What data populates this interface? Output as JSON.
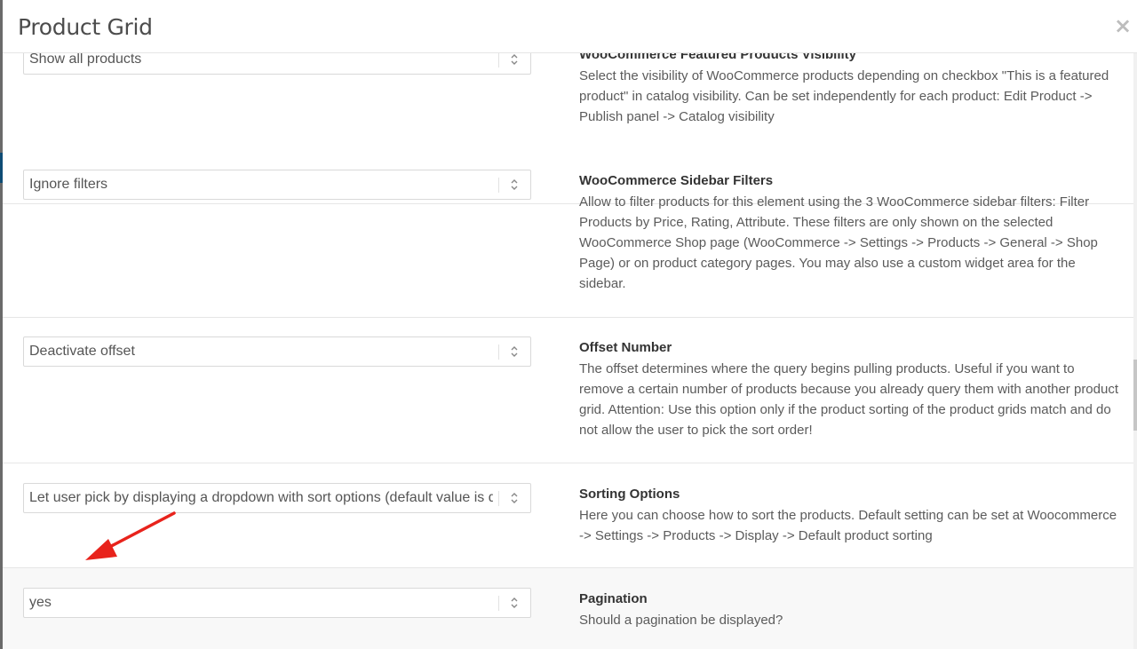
{
  "modal": {
    "title": "Product Grid",
    "close_label": "×"
  },
  "options": [
    {
      "value": "Show all products",
      "title": "WooCommerce Featured Products Visibility",
      "description": "Select the visibility of WooCommerce products depending on checkbox \"This is a featured product\" in catalog visibility. Can be set independently for each product: Edit Product -> Publish panel -> Catalog visibility"
    },
    {
      "value": "Ignore filters",
      "title": "WooCommerce Sidebar Filters",
      "description": "Allow to filter products for this element using the 3 WooCommerce sidebar filters: Filter Products by Price, Rating, Attribute. These filters are only shown on the selected WooCommerce Shop page (WooCommerce -> Settings -> Products -> General -> Shop Page) or on product category pages. You may also use a custom widget area for the sidebar."
    },
    {
      "value": "Deactivate offset",
      "title": "Offset Number",
      "description": "The offset determines where the query begins pulling products. Useful if you want to remove a certain number of products because you already query them with another product grid. Attention: Use this option only if the product sorting of the product grids match and do not allow the user to pick the sort order!"
    },
    {
      "value": "Let user pick by displaying a dropdown with sort options (default value is de",
      "title": "Sorting Options",
      "description": "Here you can choose how to sort the products. Default setting can be set at Woocommerce -> Settings -> Products -> Display -> Default product sorting"
    },
    {
      "value": "yes",
      "title": "Pagination",
      "description": "Should a pagination be displayed?"
    }
  ],
  "colors": {
    "annotation_arrow": "#e8231c",
    "highlight_row": "#f8f8f8"
  },
  "icons": {
    "close": "close-icon",
    "select": "up-down-chevron-icon",
    "annotation": "red-arrow-annotation"
  }
}
